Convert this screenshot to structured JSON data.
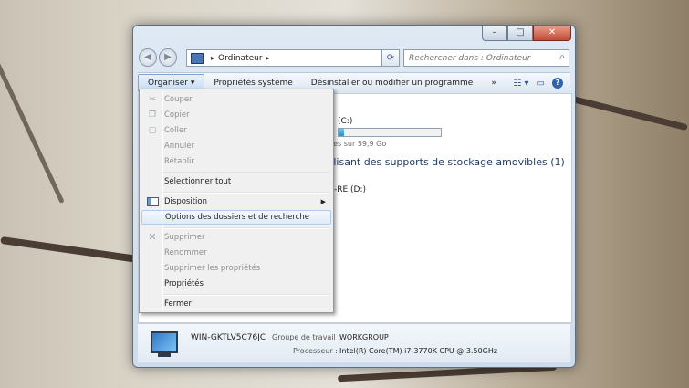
{
  "window": {
    "controls": {
      "minimize": "–",
      "maximize": "□",
      "close": "✕"
    },
    "nav": {
      "back": "◀",
      "forward": "▶"
    },
    "address": {
      "crumb": "Ordinateur",
      "arrow": "▸"
    },
    "search": {
      "placeholder": "Rechercher dans : Ordinateur"
    }
  },
  "toolbar": {
    "organiser": "Organiser ▾",
    "proprietes": "Propriétés système",
    "desinstaller": "Désinstaller ou modifier un programme",
    "more": "»"
  },
  "content": {
    "drive_c": "(C:)",
    "drive_c_free": "res sur 59,9 Go",
    "drive_c_used_fraction": 0.05,
    "removable_header": "tilisant des supports de stockage amovibles (1)",
    "drive_d": "-RE (D:)"
  },
  "details": {
    "computer_name": "WIN-GKTLV5C76JC",
    "workgroup_label": "Groupe de travail :",
    "workgroup_value": "WORKGROUP",
    "processor_label": "Processeur :",
    "processor_value": "Intel(R) Core(TM) i7-3770K CPU @ 3.50GHz"
  },
  "menu": {
    "couper": "Couper",
    "copier": "Copier",
    "coller": "Coller",
    "annuler": "Annuler",
    "retablir": "Rétablir",
    "selectionner_tout": "Sélectionner tout",
    "disposition": "Disposition",
    "options": "Options des dossiers et de recherche",
    "supprimer": "Supprimer",
    "renommer": "Renommer",
    "supprimer_proprietes": "Supprimer les propriétés",
    "proprietes": "Propriétés",
    "fermer": "Fermer"
  }
}
